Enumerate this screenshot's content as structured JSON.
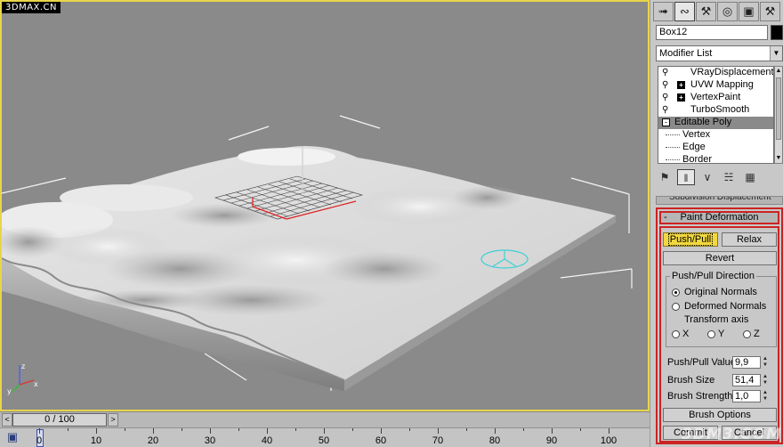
{
  "watermark": "3DMAX.CN",
  "command_panel": {
    "tabs": [
      {
        "icon": "create-icon"
      },
      {
        "icon": "modify-icon"
      },
      {
        "icon": "hierarchy-icon"
      },
      {
        "icon": "motion-icon"
      },
      {
        "icon": "display-icon"
      },
      {
        "icon": "utilities-icon"
      }
    ],
    "object_name": "Box12",
    "object_color": "#000000",
    "modifier_list_label": "Modifier List",
    "stack": [
      {
        "label": "VRayDisplacementMo",
        "icon": "bulb-icon"
      },
      {
        "label": "UVW Mapping",
        "icon": "bulb-icon",
        "expand": "+"
      },
      {
        "label": "VertexPaint",
        "icon": "bulb-icon",
        "expand": "+"
      },
      {
        "label": "TurboSmooth",
        "icon": "bulb-icon"
      },
      {
        "label": "Editable Poly",
        "expand": "-"
      },
      {
        "label": "Vertex"
      },
      {
        "label": "Edge"
      },
      {
        "label": "Border"
      }
    ],
    "rollout_above": "Subdivision Displacement",
    "paint_deformation": {
      "title": "Paint Deformation",
      "collapse": "-",
      "push_pull": "Push/Pull",
      "relax": "Relax",
      "revert": "Revert",
      "direction_group": "Push/Pull Direction",
      "original_normals": "Original Normals",
      "deformed_normals": "Deformed Normals",
      "transform_axis": "Transform axis",
      "axis_x": "X",
      "axis_y": "Y",
      "axis_z": "Z",
      "push_pull_value_label": "Push/Pull Value",
      "push_pull_value": "9,9",
      "brush_size_label": "Brush Size",
      "brush_size": "51,4",
      "brush_strength_label": "Brush Strength",
      "brush_strength": "1,0",
      "brush_options": "Brush Options",
      "commit": "Commit",
      "cancel": "Cancel"
    }
  },
  "timeline": {
    "frame_display": "0 / 100",
    "prev": "<",
    "next": ">",
    "ticks": [
      "0",
      "10",
      "20",
      "30",
      "40",
      "50",
      "60",
      "70",
      "80",
      "90",
      "100"
    ]
  },
  "logo_watermark": "3DM3.COM"
}
